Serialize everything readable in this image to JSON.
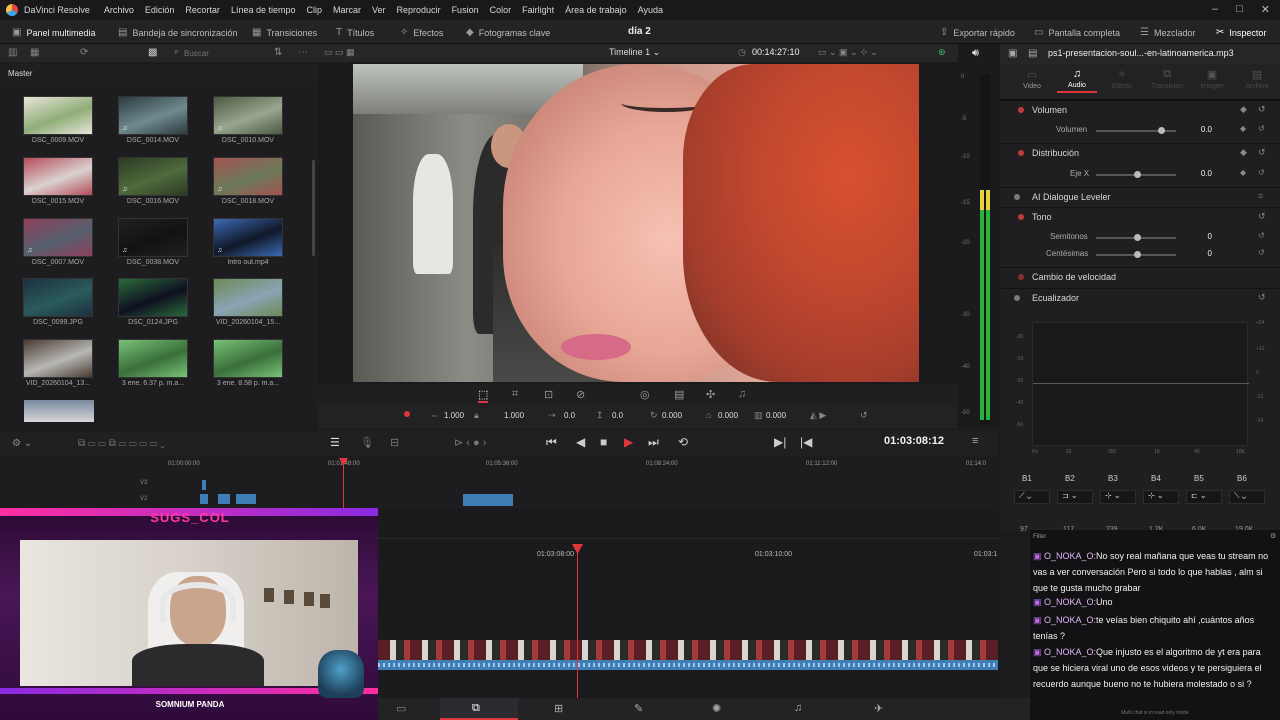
{
  "menubar": {
    "app_name": "DaVinci Resolve",
    "items": [
      "Archivo",
      "Edición",
      "Recortar",
      "Línea de tiempo",
      "Clip",
      "Marcar",
      "Ver",
      "Reproducir",
      "Fusion",
      "Color",
      "Fairlight",
      "Área de trabajo",
      "Ayuda"
    ]
  },
  "toolbar": {
    "media_panel": "Panel multimedia",
    "sync_bin": "Bandeja de sincronización",
    "transitions": "Transiciones",
    "titles": "Títulos",
    "effects": "Efectos",
    "keyframes": "Fotogramas clave",
    "project_title": "día 2",
    "quick_export": "Exportar rápido",
    "fullscreen": "Pantalla completa",
    "mixer": "Mezclador",
    "inspector": "Inspector"
  },
  "media_pool": {
    "search_placeholder": "Buscar",
    "master": "Master",
    "clips": [
      {
        "name": "DSC_0009.MOV",
        "audio": false,
        "c1": "#8fae78",
        "c2": "#e9e4d8"
      },
      {
        "name": "DSC_0014.MOV",
        "audio": true,
        "c1": "#6f8b8f",
        "c2": "#2b3b3f"
      },
      {
        "name": "DSC_0010.MOV",
        "audio": true,
        "c1": "#9aa690",
        "c2": "#4b5a42"
      },
      {
        "name": "DSC_0015.MOV",
        "audio": true,
        "c1": "#d9d2cf",
        "c2": "#b54b5a"
      },
      {
        "name": "DSC_0016.MOV",
        "audio": true,
        "c1": "#4f6b3c",
        "c2": "#2c3a24"
      },
      {
        "name": "DSC_0018.MOV",
        "audio": true,
        "c1": "#6c7b5a",
        "c2": "#a35151"
      },
      {
        "name": "DSC_0007.MOV",
        "audio": true,
        "c1": "#55606e",
        "c2": "#8f3f5a"
      },
      {
        "name": "DSC_0038.MOV",
        "audio": true,
        "c1": "#121212",
        "c2": "#202020"
      },
      {
        "name": "Intro out.mp4",
        "audio": true,
        "c1": "#101828",
        "c2": "#3d6ab5"
      },
      {
        "name": "DSC_0099.JPG",
        "audio": false,
        "c1": "#2a5b5c",
        "c2": "#1c3040"
      },
      {
        "name": "DSC_0124.JPG",
        "audio": false,
        "c1": "#0e1020",
        "c2": "#2c6a3c"
      },
      {
        "name": "VID_20260104_15...",
        "audio": false,
        "c1": "#8aa4b5",
        "c2": "#6b8a55"
      },
      {
        "name": "VID_20260104_13...",
        "audio": false,
        "c1": "#b8b8b5",
        "c2": "#4a3a30"
      },
      {
        "name": "3 ene. 6.37 p. m.a...",
        "audio": false,
        "c1": "#3a6f3a",
        "c2": "#78c278"
      },
      {
        "name": "3 ene. 8.58 p. m.a...",
        "audio": false,
        "c1": "#3a6f3a",
        "c2": "#78c278"
      }
    ]
  },
  "viewer": {
    "timeline_name": "Timeline 1",
    "timecode_top": "00:14:27:10",
    "zoom_x": "1.000",
    "zoom_y": "1.000",
    "pos_x": "0.0",
    "pos_y": "0.0",
    "rotation": "0.000",
    "crop_a": "0.000",
    "crop_b": "0.000",
    "timecode": "01:03:08:12"
  },
  "timeline": {
    "ruler_top": [
      "01:00:00:00",
      "01:01:48:00",
      "01:05:36:00",
      "01:08:24:00",
      "01:11:12:00",
      "01:14:0"
    ],
    "ruler_detail": [
      "01:03:08:00",
      "01:03:10:00",
      "01:03:1"
    ],
    "tracks": [
      "V3",
      "V2"
    ]
  },
  "inspector": {
    "file_name": "ps1-presentacion-soul...-en-latinoamerica.mp3",
    "tabs": [
      "Video",
      "Audio",
      "Efecto",
      "Transición",
      "Imagen",
      "Archivo"
    ],
    "active_tab": "Audio",
    "sections": {
      "volume": "Volumen",
      "volume_label": "Volumen",
      "volume_value": "0.0",
      "pan": "Distribución",
      "pan_label": "Eje X",
      "pan_value": "0.0",
      "dialogue": "AI Dialogue Leveler",
      "pitch": "Tono",
      "semitones": "Semitonos",
      "semitones_value": "0",
      "cents": "Centésimas",
      "cents_value": "0",
      "speed": "Cambio de velocidad",
      "eq": "Ecualizador"
    },
    "eq_db_labels": [
      "+24",
      "+12",
      "0",
      "-12",
      "-24"
    ],
    "eq_left_labels": [
      "-30",
      "-10",
      "-20",
      "-40",
      "-50"
    ],
    "eq_freq_labels": [
      "Hz",
      "62",
      "250",
      "1K",
      "4K",
      "16K"
    ],
    "bands": [
      "B1",
      "B2",
      "B3",
      "B4",
      "B5",
      "B6"
    ],
    "band_values": [
      "97",
      "117",
      "239",
      "1.2K",
      "6.0K",
      "19.0K"
    ]
  },
  "meters": {
    "scale": [
      "0",
      "-5",
      "-10",
      "-15",
      "-20",
      "-30",
      "-40",
      "-50"
    ]
  },
  "stream": {
    "streamer_name": "SUGS_COL",
    "tag": "SOMNIUM PANDA",
    "chat_header": "Filter",
    "messages": [
      {
        "user": "O_NOKA_O:",
        "text": "No soy real mañana que veas tu stream no vas a ver conversación Pero si todo lo que hablas , alm si que te gusta mucho grabar"
      },
      {
        "user": "O_NOKA_O:",
        "text": "Uno"
      },
      {
        "user": "O_NOKA_O:",
        "text": "te veías bien chiquito ahí ,cuántos años tenías ?"
      },
      {
        "user": "O_NOKA_O:",
        "text": "Que injusto es el algoritmo de yt era para que se hiciera viral uno de esos videos y te persiguiera el recuerdo aunque bueno no te hubiera molestado o si ?"
      }
    ],
    "chat_footer": "Multi chat is in read only mode"
  },
  "colors": {
    "accent_red": "#e0353b",
    "clip_blue": "#3f7fb6",
    "meter_green": "#28b43c",
    "meter_yellow": "#e6d23a"
  }
}
